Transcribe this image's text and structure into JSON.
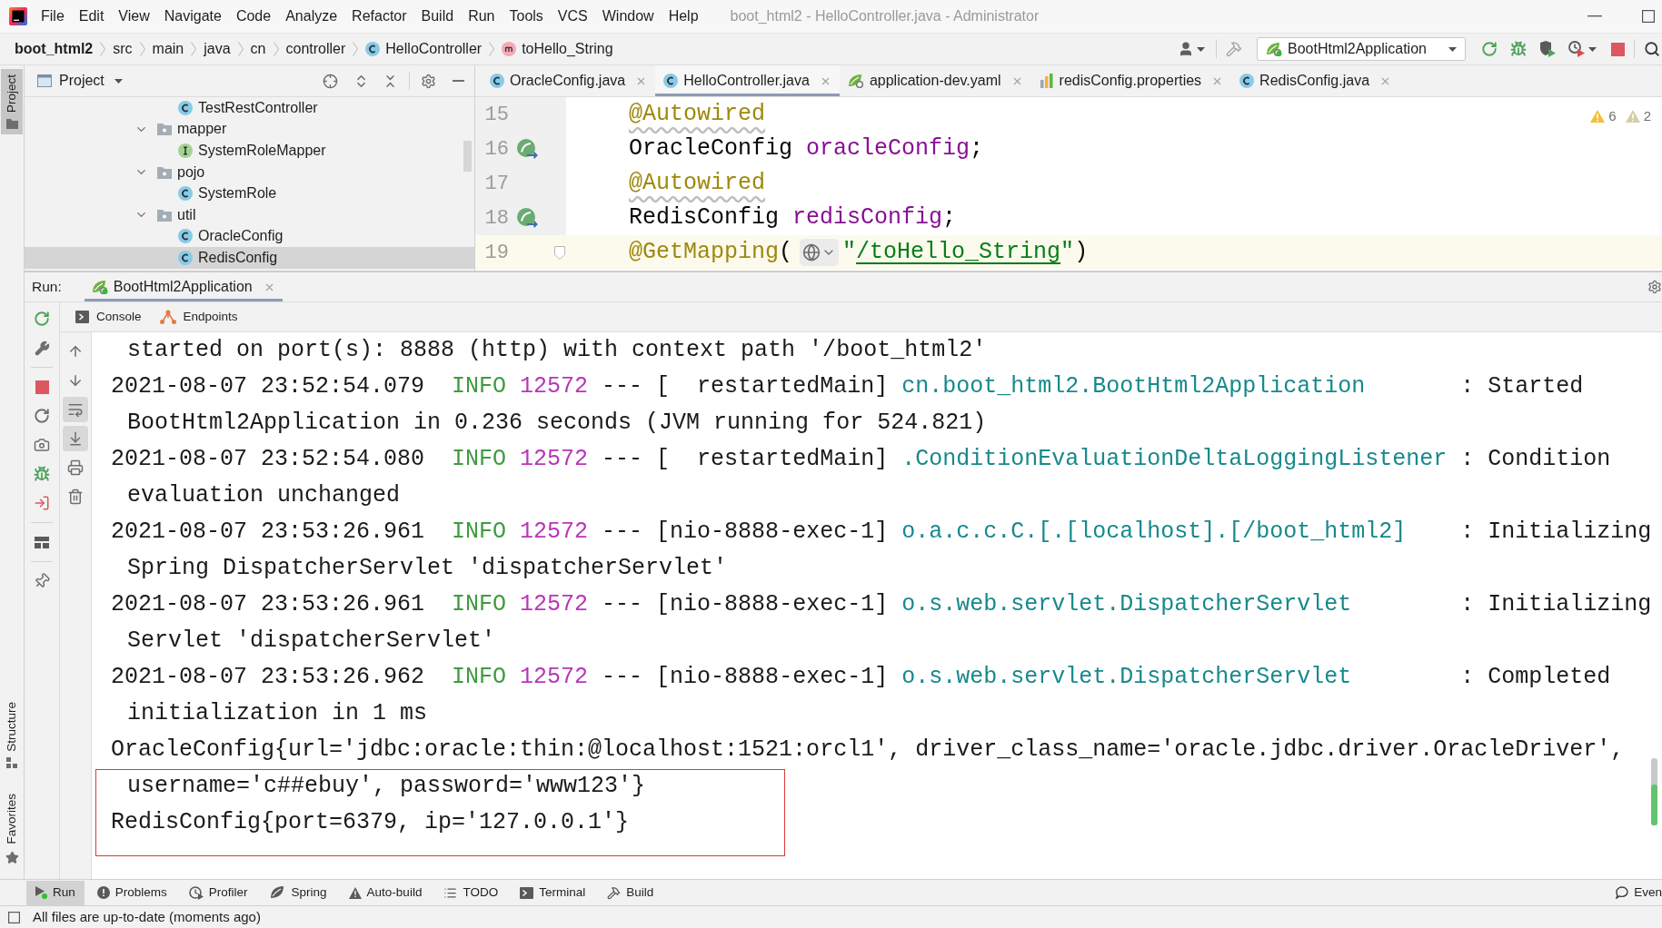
{
  "title_bar": {
    "menu": [
      "File",
      "Edit",
      "View",
      "Navigate",
      "Code",
      "Analyze",
      "Refactor",
      "Build",
      "Run",
      "Tools",
      "VCS",
      "Window",
      "Help"
    ],
    "title": "boot_html2 - HelloController.java - Administrator"
  },
  "navigation_bar": {
    "breadcrumb": [
      {
        "label": "boot_html2",
        "kind": "project"
      },
      {
        "label": "src",
        "kind": "folder"
      },
      {
        "label": "main",
        "kind": "folder"
      },
      {
        "label": "java",
        "kind": "folder"
      },
      {
        "label": "cn",
        "kind": "folder"
      },
      {
        "label": "controller",
        "kind": "folder"
      },
      {
        "label": "HelloController",
        "kind": "class"
      },
      {
        "label": "toHello_String",
        "kind": "method"
      }
    ],
    "run_configuration": "BootHtml2Application"
  },
  "tool_stripe": {
    "top": [
      {
        "label": "Project",
        "kind": "project",
        "selected": true
      }
    ],
    "bottom": [
      {
        "label": "Structure",
        "kind": "structure",
        "selected": false
      },
      {
        "label": "Favorites",
        "kind": "favorites",
        "selected": false
      }
    ]
  },
  "project_panel": {
    "title": "Project",
    "tree": [
      {
        "children": [
          {
            "label": "TestRestController",
            "kind": "class",
            "selected": false
          }
        ]
      },
      {
        "label": "mapper",
        "kind": "package",
        "expanded": true,
        "selected": false,
        "children": [
          {
            "label": "SystemRoleMapper",
            "kind": "interface",
            "selected": false
          }
        ]
      },
      {
        "label": "pojo",
        "kind": "package",
        "expanded": true,
        "selected": false,
        "children": [
          {
            "label": "SystemRole",
            "kind": "class",
            "selected": false
          }
        ]
      },
      {
        "label": "util",
        "kind": "package",
        "expanded": true,
        "selected": false,
        "children": [
          {
            "label": "OracleConfig",
            "kind": "class",
            "selected": false
          },
          {
            "label": "RedisConfig",
            "kind": "class",
            "selected": true
          }
        ]
      }
    ]
  },
  "editor": {
    "tabs": [
      {
        "label": "OracleConfig.java",
        "kind": "class",
        "selected": false
      },
      {
        "label": "HelloController.java",
        "kind": "class",
        "selected": true
      },
      {
        "label": "application-dev.yaml",
        "kind": "spring",
        "selected": false
      },
      {
        "label": "redisConfig.properties",
        "kind": "properties",
        "selected": false
      },
      {
        "label": "RedisConfig.java",
        "kind": "class",
        "selected": false
      }
    ],
    "problems": [
      {
        "kind": "warning",
        "count": "6"
      },
      {
        "kind": "weak_warning",
        "count": "2"
      }
    ],
    "lines": [
      {
        "number": "15",
        "kind": "annotation",
        "text": "@Autowired",
        "squiggle": true,
        "bean": false,
        "fold": false,
        "current": false
      },
      {
        "number": "16",
        "kind": "field",
        "type": "OracleConfig",
        "name": "oracleConfig",
        "end": ";",
        "bean": true,
        "fold": false,
        "current": false
      },
      {
        "number": "17",
        "kind": "annotation",
        "text": "@Autowired",
        "squiggle": true,
        "bean": false,
        "fold": false,
        "current": false
      },
      {
        "number": "18",
        "kind": "field",
        "type": "RedisConfig",
        "name": "redisConfig",
        "end": ";",
        "bean": true,
        "fold": false,
        "current": false
      },
      {
        "number": "19",
        "kind": "mapping",
        "annotation": "@GetMapping",
        "open": "(",
        "quote_open": "\"",
        "path": "/toHello_String",
        "quote_close": "\"",
        "close": ")",
        "bean": false,
        "fold": true,
        "current": true
      }
    ]
  },
  "run_panel": {
    "label": "Run:",
    "tabs": [
      {
        "label": "BootHtml2Application",
        "selected": true
      }
    ],
    "views": [
      {
        "label": "Console",
        "kind": "console"
      },
      {
        "label": "Endpoints",
        "kind": "endpoints"
      }
    ],
    "console_toggles": [
      {
        "on": false
      },
      {
        "on": false
      },
      {
        "on": true
      },
      {
        "on": true
      },
      {
        "on": false
      },
      {
        "on": false
      }
    ],
    "console": [
      {
        "kind": "wrap",
        "text": "started on port(s): 8888 (http) with context path '/boot_html2'"
      },
      {
        "kind": "log",
        "time": "2021-08-07 23:52:54.079",
        "level": "INFO",
        "pid": "12572",
        "thread": "--- [  restartedMain]",
        "logger": "cn.boot_html2.BootHtml2Application",
        "message": ": Started"
      },
      {
        "kind": "wrap",
        "text": "BootHtml2Application in 0.236 seconds (JVM running for 524.821)"
      },
      {
        "kind": "log",
        "time": "2021-08-07 23:52:54.080",
        "level": "INFO",
        "pid": "12572",
        "thread": "--- [  restartedMain]",
        "logger": ".ConditionEvaluationDeltaLoggingListener",
        "message": ": Condition"
      },
      {
        "kind": "wrap",
        "text": "evaluation unchanged"
      },
      {
        "kind": "log",
        "time": "2021-08-07 23:53:26.961",
        "level": "INFO",
        "pid": "12572",
        "thread": "--- [nio-8888-exec-1]",
        "logger": "o.a.c.c.C.[.[localhost].[/boot_html2]",
        "message": ": Initializing"
      },
      {
        "kind": "wrap",
        "text": "Spring DispatcherServlet 'dispatcherServlet'"
      },
      {
        "kind": "log",
        "time": "2021-08-07 23:53:26.961",
        "level": "INFO",
        "pid": "12572",
        "thread": "--- [nio-8888-exec-1]",
        "logger": "o.s.web.servlet.DispatcherServlet",
        "message": ": Initializing"
      },
      {
        "kind": "wrap",
        "text": "Servlet 'dispatcherServlet'"
      },
      {
        "kind": "log",
        "time": "2021-08-07 23:53:26.962",
        "level": "INFO",
        "pid": "12572",
        "thread": "--- [nio-8888-exec-1]",
        "logger": "o.s.web.servlet.DispatcherServlet",
        "message": ": Completed"
      },
      {
        "kind": "wrap",
        "text": "initialization in 1 ms"
      },
      {
        "kind": "text",
        "text": "OracleConfig{url='jdbc:oracle:thin:@localhost:1521:orcl1', driver_class_name='oracle.jdbc.driver.OracleDriver',"
      },
      {
        "kind": "wrap",
        "text": "username='c##ebuy', password='www123'}"
      },
      {
        "kind": "text",
        "text": "RedisConfig{port=6379, ip='127.0.0.1'}"
      }
    ]
  },
  "tool_window_bar": {
    "items": [
      {
        "label": "Run",
        "kind": "run",
        "selected": true
      },
      {
        "label": "Problems",
        "kind": "problems",
        "selected": false
      },
      {
        "label": "Profiler",
        "kind": "profiler",
        "selected": false
      },
      {
        "label": "Spring",
        "kind": "spring",
        "selected": false
      },
      {
        "label": "Auto-build",
        "kind": "auto_build",
        "selected": false
      },
      {
        "label": "TODO",
        "kind": "todo",
        "selected": false
      },
      {
        "label": "Terminal",
        "kind": "terminal",
        "selected": false
      },
      {
        "label": "Build",
        "kind": "build",
        "selected": false
      }
    ],
    "right": [
      {
        "label": "Even",
        "kind": "event_log",
        "selected": false
      }
    ]
  },
  "status_bar": {
    "message": "All files are up-to-date (moments ago)"
  }
}
